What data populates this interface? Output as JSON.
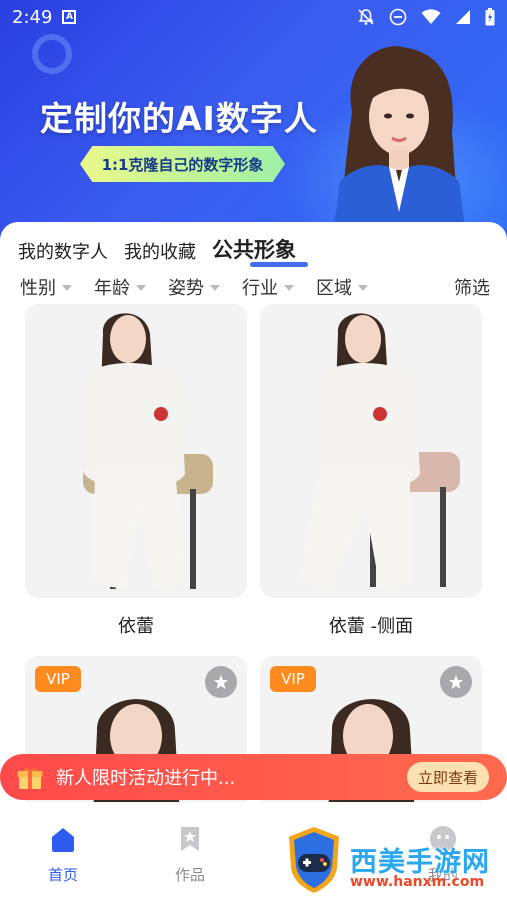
{
  "status_bar": {
    "time": "2:49",
    "app_icon": "A"
  },
  "banner": {
    "title": "定制你的AI数字人",
    "subtitle": "1:1克隆自己的数字形象"
  },
  "tabs": [
    {
      "label": "我的数字人",
      "active": false
    },
    {
      "label": "我的收藏",
      "active": false
    },
    {
      "label": "公共形象",
      "active": true
    }
  ],
  "filters": {
    "items": [
      "性别",
      "年龄",
      "姿势",
      "行业",
      "区域"
    ],
    "screen_label": "筛选"
  },
  "cards": [
    {
      "name": "依蕾",
      "vip": false,
      "favorite_button": false
    },
    {
      "name": "依蕾 -侧面",
      "vip": false,
      "favorite_button": false
    },
    {
      "name": "",
      "vip": true,
      "vip_label": "VIP",
      "favorite_button": true
    },
    {
      "name": "",
      "vip": true,
      "vip_label": "VIP",
      "favorite_button": true
    }
  ],
  "promo": {
    "text": "新人限时活动进行中...",
    "button": "立即查看"
  },
  "bottom_nav": [
    {
      "label": "首页",
      "icon": "home-icon",
      "active": true
    },
    {
      "label": "作品",
      "icon": "works-icon",
      "active": false
    },
    {
      "label": "",
      "icon": "crown-icon",
      "active": false
    },
    {
      "label": "我的",
      "icon": "profile-icon",
      "active": false
    }
  ],
  "watermark": {
    "brand": "西美手游网",
    "url": "www.hanxm.com"
  },
  "colors": {
    "accent": "#2f5cf0",
    "vip": "#ff8a1e",
    "promo": "#ff4a4a"
  }
}
